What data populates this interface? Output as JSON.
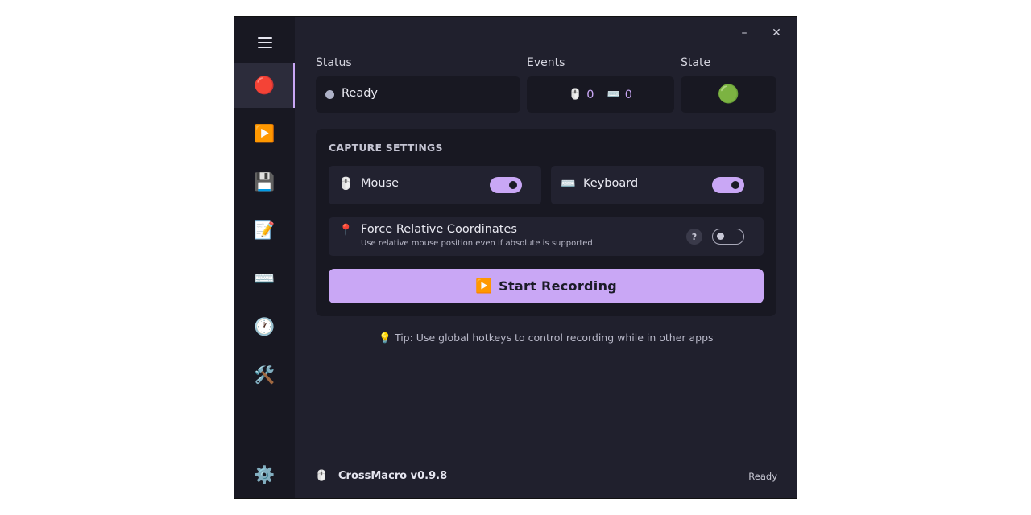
{
  "window": {
    "minimize_glyph": "–",
    "close_glyph": "✕"
  },
  "sidebar": {
    "menu_icon": "hamburger-menu-icon",
    "items": [
      {
        "name": "record",
        "glyph": "🔴",
        "active": true
      },
      {
        "name": "playback",
        "glyph": "▶️",
        "active": false
      },
      {
        "name": "save",
        "glyph": "💾",
        "active": false
      },
      {
        "name": "editor",
        "glyph": "📝",
        "active": false
      },
      {
        "name": "shortcuts",
        "glyph": "⌨️",
        "active": false
      },
      {
        "name": "scheduler",
        "glyph": "🕐",
        "active": false
      },
      {
        "name": "tools",
        "glyph": "🛠️",
        "active": false
      }
    ],
    "settings_glyph": "⚙️"
  },
  "summary": {
    "status_label": "Status",
    "status_value": "Ready",
    "events_label": "Events",
    "mouse_glyph": "🖱️",
    "mouse_count": "0",
    "keyboard_glyph": "⌨️",
    "keyboard_count": "0",
    "state_label": "State",
    "state_glyph": "🟢"
  },
  "capture": {
    "title": "CAPTURE SETTINGS",
    "mouse": {
      "glyph": "🖱️",
      "label": "Mouse",
      "enabled": true
    },
    "keyboard": {
      "glyph": "⌨️",
      "label": "Keyboard",
      "enabled": true
    },
    "relative": {
      "glyph": "📍",
      "label": "Force Relative Coordinates",
      "description": "Use relative mouse position even if absolute is supported",
      "help": "?",
      "enabled": false
    },
    "start_glyph": "▶️",
    "start_label": "Start Recording"
  },
  "tip": "💡 Tip: Use global hotkeys to control recording while in other apps",
  "footer": {
    "glyph": "🖱️",
    "app_name": "CrossMacro v0.9.8",
    "status": "Ready"
  },
  "colors": {
    "accent": "#c9a7f5",
    "window_bg": "#20202d",
    "card_bg": "#181822",
    "count_color": "#c9a7f5"
  }
}
